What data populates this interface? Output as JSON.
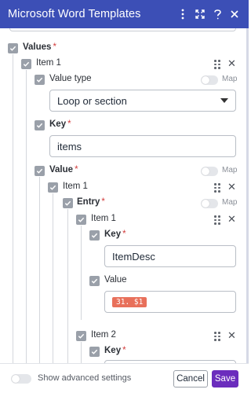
{
  "header": {
    "title": "Microsoft Word Templates"
  },
  "form": {
    "values_label": "Values",
    "required_mark": "*",
    "map_label": "Map",
    "item1_label": "Item 1",
    "value_type_label": "Value type",
    "value_type_selected": "Loop or section",
    "key_label": "Key",
    "key_value": "items",
    "value_label": "Value",
    "inner_item1_label": "Item 1",
    "entry_label": "Entry",
    "entry_item1_label": "Item 1",
    "entry_key_label": "Key",
    "entry_key_value": "ItemDesc",
    "entry_value_label": "Value",
    "entry_value_pill": "31. $1",
    "entry_item2_label": "Item 2",
    "entry_item2_key_label": "Key"
  },
  "footer": {
    "advanced_label": "Show advanced settings",
    "cancel_label": "Cancel",
    "save_label": "Save"
  },
  "colors": {
    "header_bg": "#3c4fb6",
    "save_bg": "#6b2dbd",
    "pill_bg": "#e8705b",
    "required": "#d23c3c"
  }
}
